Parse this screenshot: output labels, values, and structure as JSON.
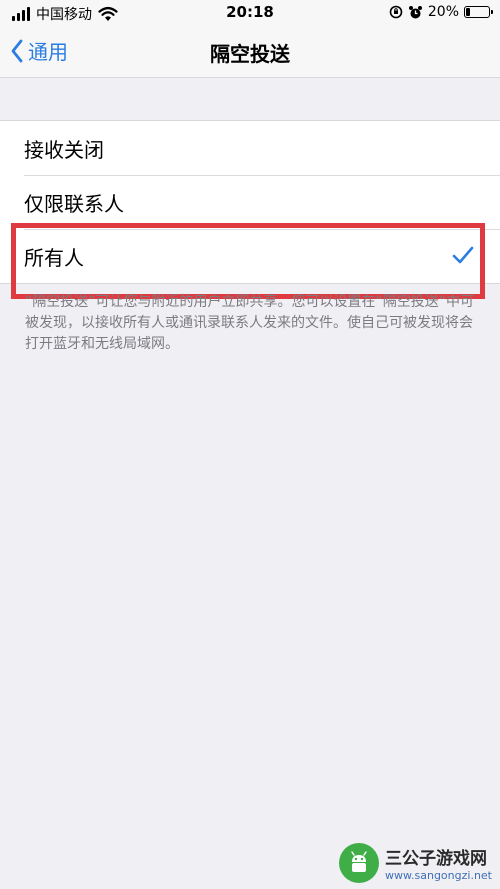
{
  "status_bar": {
    "carrier": "中国移动",
    "time": "20:18",
    "battery_percent": "20%",
    "battery_level": 0.2,
    "icons": [
      "signal-icon",
      "wifi-icon",
      "rotation-lock-icon",
      "alarm-icon",
      "battery-icon"
    ]
  },
  "nav": {
    "back_label": "通用",
    "title": "隔空投送"
  },
  "options": [
    {
      "label": "接收关闭",
      "selected": false
    },
    {
      "label": "仅限联系人",
      "selected": false
    },
    {
      "label": "所有人",
      "selected": true
    }
  ],
  "footer_note": "“隔空投送”可让您与附近的用户立即共享。您可以设置在“隔空投送”中可被发现，以接收所有人或通讯录联系人发来的文件。使自己可被发现将会打开蓝牙和无线局域网。",
  "colors": {
    "accent": "#2a7de1",
    "highlight": "#e03a41",
    "background": "#efeff4"
  },
  "watermark": {
    "title": "三公子游戏网",
    "url": "www.sangongzi.net"
  }
}
